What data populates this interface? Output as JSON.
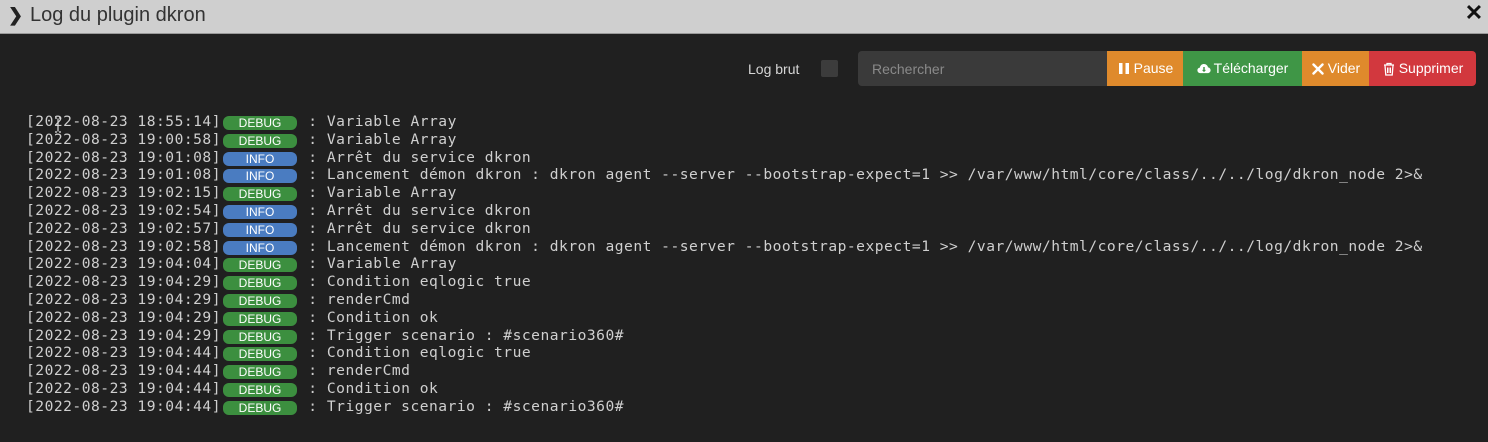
{
  "titlebar": {
    "chevron_icon": "chevron-right-icon",
    "title": "Log du plugin dkron",
    "close_icon": "close-icon"
  },
  "toolbar": {
    "raw_log_label": "Log brut",
    "raw_log_checked": false,
    "search_placeholder": "Rechercher",
    "search_value": "",
    "pause_label": "Pause",
    "download_label": "Télécharger",
    "empty_label": "Vider",
    "delete_label": "Supprimer",
    "colors": {
      "pause": "#df8a2c",
      "download": "#3f9646",
      "empty": "#df8a2c",
      "delete": "#d2383e",
      "debug_badge": "#3c8f3f",
      "info_badge": "#4a7cc1"
    }
  },
  "log": [
    {
      "ts": "[2022-08-23 18:55:14]",
      "level": "DEBUG",
      "msg": " : Variable Array"
    },
    {
      "ts": "[2022-08-23 19:00:58]",
      "level": "DEBUG",
      "msg": " : Variable Array"
    },
    {
      "ts": "[2022-08-23 19:01:08]",
      "level": "INFO",
      "msg": " : Arrêt du service dkron"
    },
    {
      "ts": "[2022-08-23 19:01:08]",
      "level": "INFO",
      "msg": " : Lancement démon dkron : dkron agent --server --bootstrap-expect=1 >> /var/www/html/core/class/../../log/dkron_node 2>&"
    },
    {
      "ts": "[2022-08-23 19:02:15]",
      "level": "DEBUG",
      "msg": " : Variable Array"
    },
    {
      "ts": "[2022-08-23 19:02:54]",
      "level": "INFO",
      "msg": " : Arrêt du service dkron"
    },
    {
      "ts": "[2022-08-23 19:02:57]",
      "level": "INFO",
      "msg": " : Arrêt du service dkron"
    },
    {
      "ts": "[2022-08-23 19:02:58]",
      "level": "INFO",
      "msg": " : Lancement démon dkron : dkron agent --server --bootstrap-expect=1 >> /var/www/html/core/class/../../log/dkron_node 2>&"
    },
    {
      "ts": "[2022-08-23 19:04:04]",
      "level": "DEBUG",
      "msg": " : Variable Array"
    },
    {
      "ts": "[2022-08-23 19:04:29]",
      "level": "DEBUG",
      "msg": " : Condition eqlogic true"
    },
    {
      "ts": "[2022-08-23 19:04:29]",
      "level": "DEBUG",
      "msg": " : renderCmd"
    },
    {
      "ts": "[2022-08-23 19:04:29]",
      "level": "DEBUG",
      "msg": " : Condition ok"
    },
    {
      "ts": "[2022-08-23 19:04:29]",
      "level": "DEBUG",
      "msg": " : Trigger scenario : #scenario360#"
    },
    {
      "ts": "[2022-08-23 19:04:44]",
      "level": "DEBUG",
      "msg": " : Condition eqlogic true"
    },
    {
      "ts": "[2022-08-23 19:04:44]",
      "level": "DEBUG",
      "msg": " : renderCmd"
    },
    {
      "ts": "[2022-08-23 19:04:44]",
      "level": "DEBUG",
      "msg": " : Condition ok"
    },
    {
      "ts": "[2022-08-23 19:04:44]",
      "level": "DEBUG",
      "msg": " : Trigger scenario : #scenario360#"
    }
  ]
}
